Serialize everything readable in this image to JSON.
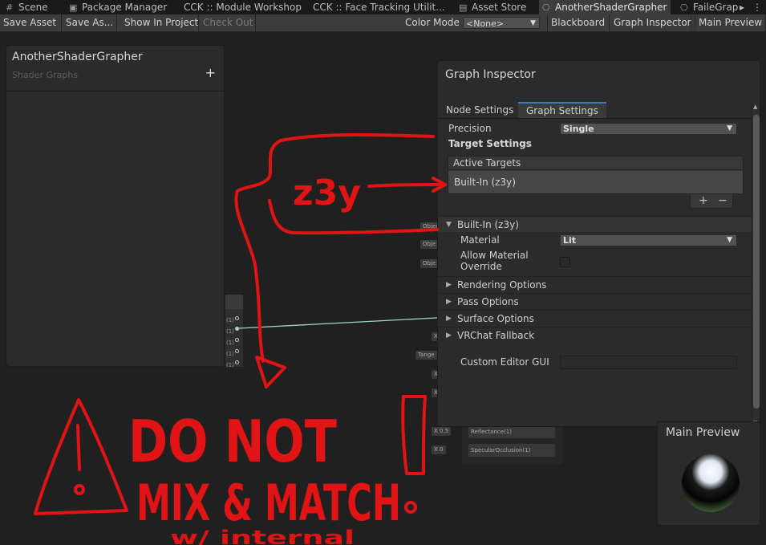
{
  "tabs": [
    {
      "label": "Scene",
      "icon": "grid-icon"
    },
    {
      "label": "Package Manager",
      "icon": "package-icon"
    },
    {
      "label": "CCK :: Module Workshop",
      "icon": ""
    },
    {
      "label": "CCK :: Face Tracking Utilit...",
      "icon": ""
    },
    {
      "label": "Asset Store",
      "icon": "store-icon"
    },
    {
      "label": "AnotherShaderGrapher",
      "icon": "shader-graph-icon"
    },
    {
      "label": "FaileGrap",
      "icon": "shader-graph-icon"
    }
  ],
  "toolbar": {
    "save_asset": "Save Asset",
    "save_as": "Save As...",
    "show_in_project": "Show In Project",
    "check_out": "Check Out",
    "color_mode_label": "Color Mode",
    "color_mode_value": "<None>",
    "blackboard": "Blackboard",
    "graph_inspector": "Graph Inspector",
    "main_preview": "Main Preview"
  },
  "blackboard": {
    "title": "AnotherShaderGrapher",
    "subtitle": "Shader Graphs",
    "add_symbol": "+"
  },
  "graph_nodes": {
    "object_labels": [
      "Objec",
      "Obje",
      "Obje"
    ],
    "port_labels": [
      "(1)",
      "(1)",
      "(1)",
      "(1)",
      "(1)"
    ],
    "tangent_label": "Tange",
    "x_labels": [
      "X",
      "X",
      "X"
    ],
    "reflectance_value": "0.5",
    "specular_value": "0",
    "reflectance_label": "Reflectance(1)",
    "specular_label": "SpecularOcclusion(1)"
  },
  "inspector": {
    "title": "Graph Inspector",
    "tabs": [
      "Node Settings",
      "Graph Settings"
    ],
    "active_tab": 1,
    "precision_label": "Precision",
    "precision_value": "Single",
    "target_settings_label": "Target Settings",
    "active_targets_header": "Active Targets",
    "active_target_item": "Built-In (z3y)",
    "add_symbol": "+",
    "remove_symbol": "−",
    "builtin_foldout": "Built-In (z3y)",
    "material_label": "Material",
    "material_value": "Lit",
    "allow_override_label_1": "Allow Material",
    "allow_override_label_2": "Override",
    "allow_override_checked": false,
    "foldouts": [
      "Rendering Options",
      "Pass Options",
      "Surface Options",
      "VRChat Fallback"
    ],
    "custom_editor_label": "Custom Editor GUI",
    "custom_editor_value": ""
  },
  "preview": {
    "title": "Main Preview"
  },
  "annotation": {
    "color": "#e01414",
    "label_z3y": "z3y",
    "warning_line1": "DO NOT",
    "warning_line2": "MIX & MATCH",
    "warning_line3": "w/ internal"
  }
}
